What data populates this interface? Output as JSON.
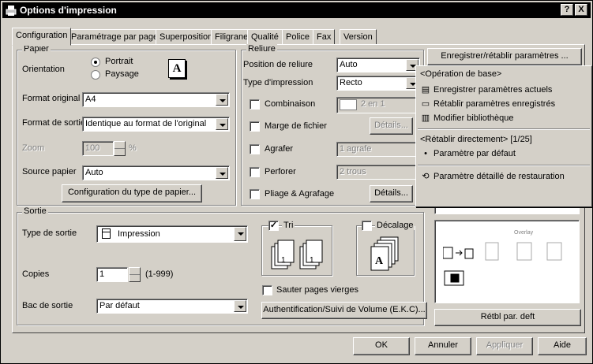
{
  "window": {
    "title": "Options d'impression",
    "help_label": "?",
    "close_label": "X"
  },
  "tabs": [
    "Configuration",
    "Paramétrage par page",
    "Superposition",
    "Filigrane",
    "Qualité",
    "Police",
    "Fax",
    "Version"
  ],
  "paper": {
    "group_label": "Papier",
    "orientation_label": "Orientation",
    "portrait_label": "Portrait",
    "landscape_label": "Paysage",
    "orientation_selected": "Portrait",
    "orientation_preview": "A",
    "format_original_label": "Format original",
    "format_original_value": "A4",
    "format_sortie_label": "Format de sortie",
    "format_sortie_value": "Identique au format de l'original",
    "zoom_label": "Zoom",
    "zoom_value": "100",
    "zoom_unit": "%",
    "source_label": "Source papier",
    "source_value": "Auto",
    "paper_type_button": "Configuration du type de papier..."
  },
  "binding": {
    "group_label": "Reliure",
    "position_label": "Position de reliure",
    "position_value": "Auto",
    "print_type_label": "Type d'impression",
    "print_type_value": "Recto",
    "combine_label": "Combinaison",
    "combine_value": "2 en 1",
    "margin_label": "Marge de fichier",
    "margin_details": "Détails...",
    "staple_label": "Agrafer",
    "staple_value": "1 agrafe",
    "punch_label": "Perforer",
    "punch_value": "2 trous",
    "fold_label": "Pliage & Agrafage",
    "fold_details": "Détails..."
  },
  "output": {
    "group_label": "Sortie",
    "type_label": "Type de sortie",
    "type_value": "Impression",
    "copies_label": "Copies",
    "copies_value": "1",
    "copies_range": "(1-999)",
    "tray_label": "Bac de sortie",
    "tray_value": "Par défaut",
    "sort_label": "Tri",
    "sort_checked": true,
    "offset_label": "Décalage",
    "offset_checked": false,
    "skip_blank_label": "Sauter pages vierges",
    "auth_button": "Authentification/Suivi de Volume (E.K.C)..."
  },
  "right": {
    "save_restore_button": "Enregistrer/rétablir paramètres ...",
    "overlay_caption": "Overlay",
    "restore_default_button": "Rétbl par. deft"
  },
  "menu": {
    "basic_header": "<Opération de base>",
    "save_current": "Enregistrer paramètres actuels",
    "restore_saved": "Rétablir paramètres enregistrés",
    "edit_library": "Modifier bibliothèque",
    "direct_header": "<Rétablir directement>  [1/25]",
    "default_param": "Paramètre par défaut",
    "detailed_restore": "Paramètre détaillé de restauration"
  },
  "footer": {
    "ok": "OK",
    "cancel": "Annuler",
    "apply": "Appliquer",
    "help": "Aide"
  }
}
